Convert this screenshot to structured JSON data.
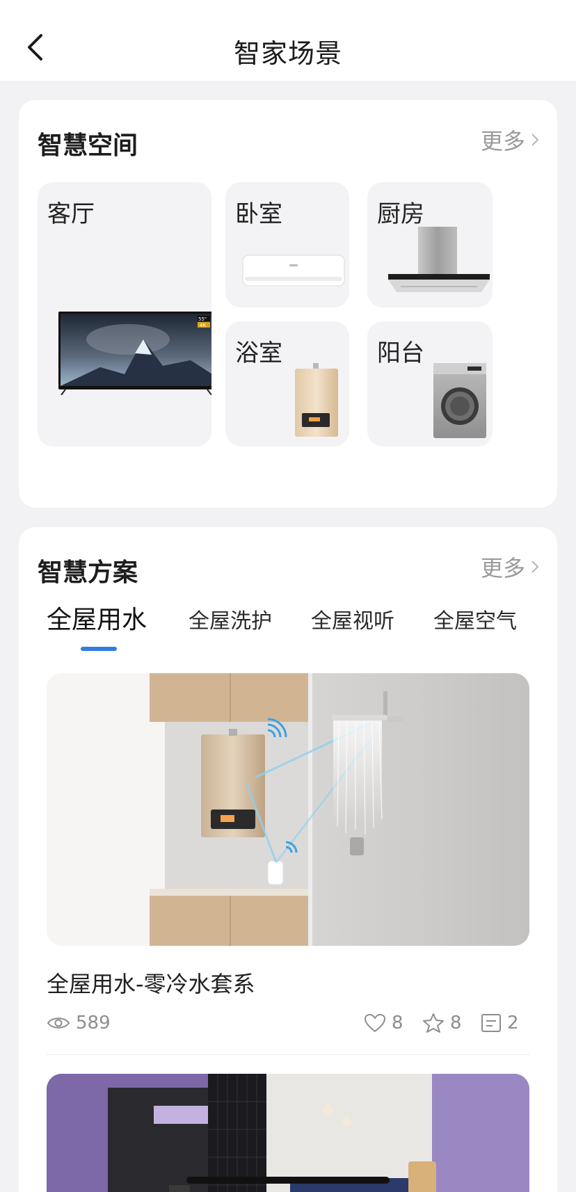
{
  "header": {
    "title": "智家场景"
  },
  "spaces": {
    "title": "智慧空间",
    "more": "更多",
    "rooms": [
      {
        "label": "客厅",
        "device": "tv-image"
      },
      {
        "label": "卧室",
        "device": "air-conditioner-image"
      },
      {
        "label": "厨房",
        "device": "range-hood-image"
      },
      {
        "label": "浴室",
        "device": "water-heater-image"
      },
      {
        "label": "阳台",
        "device": "washing-machine-image"
      }
    ],
    "tv_badge_size": "55\"",
    "tv_badge_res": "4K"
  },
  "plans": {
    "title": "智慧方案",
    "more": "更多",
    "tabs": [
      "全屋用水",
      "全屋洗护",
      "全屋视听",
      "全屋空气"
    ],
    "active_tab": "全屋用水",
    "items": [
      {
        "title": "全屋用水-零冷水套系",
        "views": "589",
        "likes": "8",
        "favorites": "8",
        "comments": "2"
      }
    ]
  },
  "colors": {
    "accent": "#2f7de1",
    "card": "#ffffff",
    "background": "#f2f2f4",
    "muted": "#9a9a9a"
  }
}
